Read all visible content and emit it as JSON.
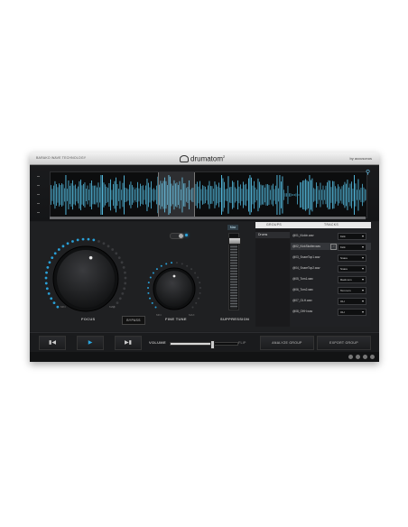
{
  "titlebar": {
    "tagline": "BARAKO WAVE TECHNOLOGY",
    "product": "drumatom",
    "product_sup": "2",
    "brand": "by accusonus"
  },
  "colors": {
    "accent": "#2aa6e0",
    "waveform": "#58c4ea",
    "panel": "#1f2022"
  },
  "waveform": {
    "selection_start": 0.34,
    "selection_end": 0.45
  },
  "knobs": {
    "focus": {
      "label": "FOCUS",
      "min_label": "MIN",
      "max_label": "MAX",
      "value": 0.55
    },
    "fine_tune": {
      "label": "FINE TUNE",
      "min_label": "MIN",
      "max_label": "MAX",
      "value": 0.5
    }
  },
  "bypass_label": "BYPASS",
  "suppression": {
    "label": "SUPPRESSION",
    "value_label": "Max",
    "level": 0.95
  },
  "table": {
    "groups_header": "GROUPS",
    "tracks_header": "TRACKS",
    "groups": [
      "Drums"
    ],
    "tracks": [
      {
        "name": "@01_Kickln.wav",
        "type": "Kick",
        "selected": false
      },
      {
        "name": "@02_KickSkotter.wav",
        "type": "Kick",
        "selected": true
      },
      {
        "name": "@03_SnareTop1.wav",
        "type": "Snare",
        "selected": false
      },
      {
        "name": "@04_SnareTop2.wav",
        "type": "Snare",
        "selected": false
      },
      {
        "name": "@05_Tom1.wav",
        "type": "Rack tom",
        "selected": false
      },
      {
        "name": "@06_Tom2.wav",
        "type": "Tom tom",
        "selected": false
      },
      {
        "name": "@07_OLH.wav",
        "type": "OH",
        "selected": false
      },
      {
        "name": "@08_OHH.wav",
        "type": "OH",
        "selected": false
      }
    ]
  },
  "transport": {
    "prev_icon": "skip-back-icon",
    "play_icon": "play-icon",
    "next_icon": "skip-forward-icon",
    "volume_label": "VOLUME",
    "volume_value_label": "FLIP",
    "volume_level": 0.62
  },
  "actions": {
    "analyze": "ANALYZE GROUP",
    "export": "EXPORT GROUP"
  },
  "status_icons": [
    "settings-icon",
    "zoom-icon",
    "help-icon",
    "info-icon"
  ]
}
